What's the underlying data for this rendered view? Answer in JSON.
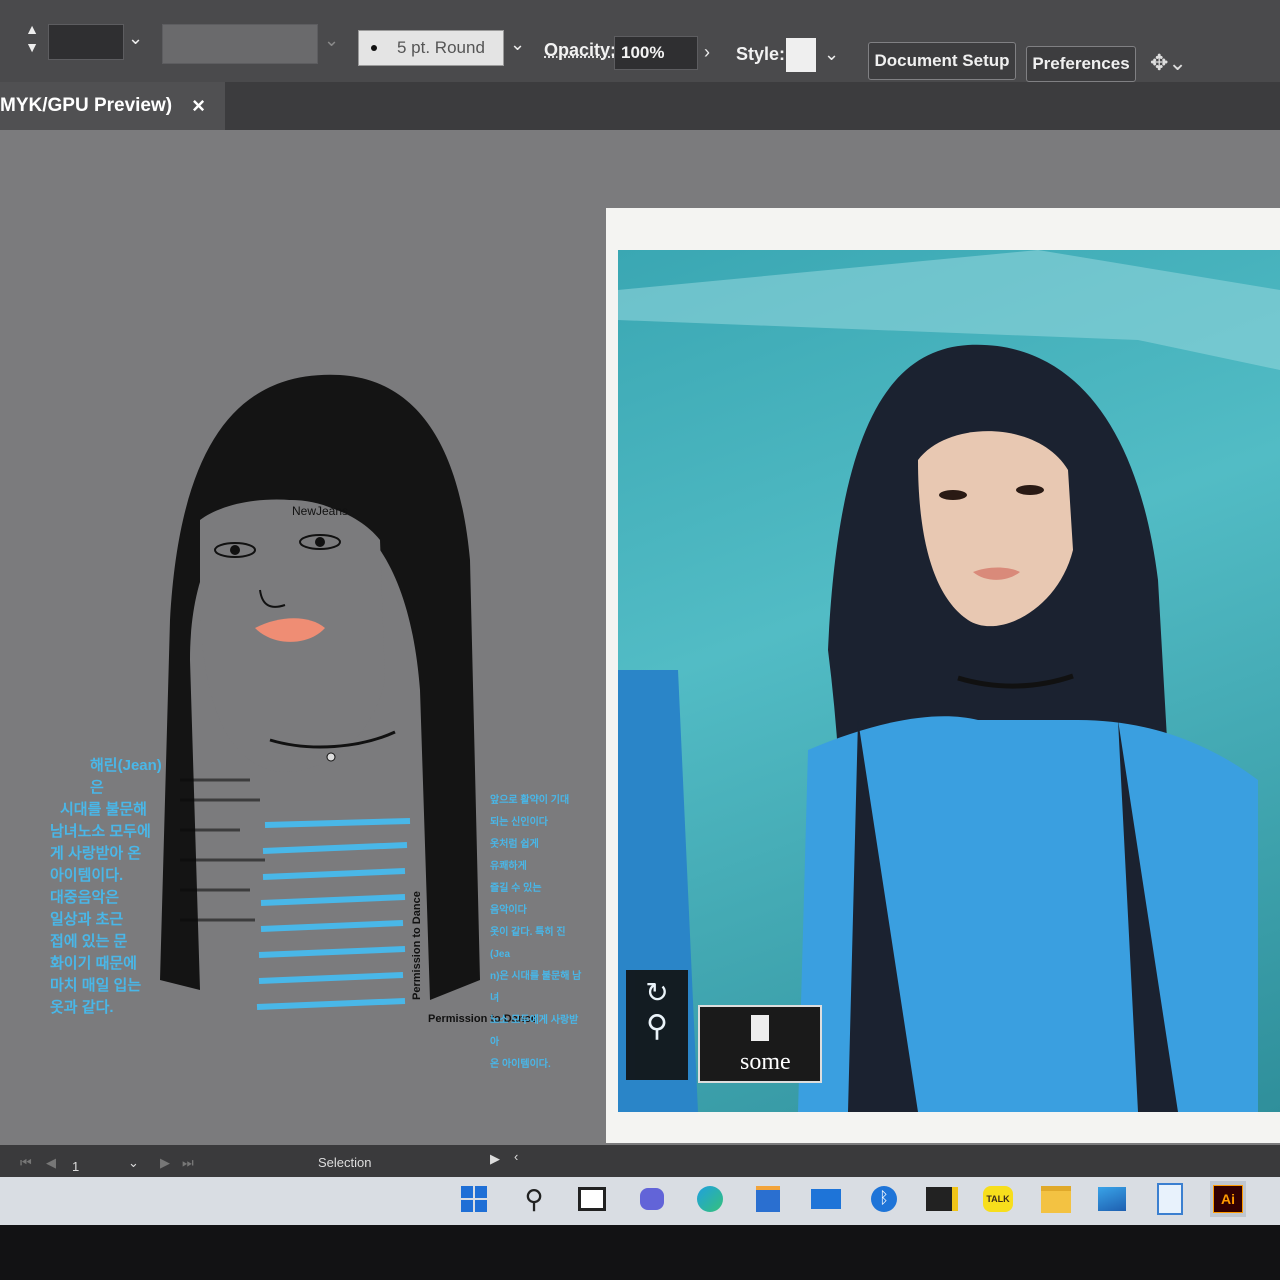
{
  "control_bar": {
    "stroke_profile": "5 pt. Round",
    "opacity_label": "Opacity:",
    "opacity_value": "100%",
    "style_label": "Style:",
    "document_setup": "Document Setup",
    "preferences": "Preferences"
  },
  "document_tab": {
    "title": "MYK/GPU Preview)",
    "close_glyph": "×"
  },
  "artwork": {
    "portrait_texts": [
      "NewJeans",
      "Permission to Dance",
      "Permission to Dance"
    ],
    "left_block": [
      "해린(Jean)은",
      "시대를 불문해",
      "남녀노소 모두에",
      "게 사랑받아 온",
      "아이템이다.",
      "대중음악은",
      "일상과 초근",
      "접에 있는 문",
      "화이기 때문에",
      "마치 매일 입는",
      "옷과 같다."
    ],
    "right_block": [
      "앞으로 활약이 기대",
      "되는 신인이다",
      "옷처럼 쉽게",
      "유쾌하게",
      "즐길 수 있는",
      "음악이다",
      "옷이 같다. 특히 진(Jea",
      "n)은 시대를 불문해 남녀",
      "노소 모두에게 사랑받아",
      "온 아이템이다."
    ],
    "colors": {
      "hair_text": "#111111",
      "lips": "#ef8d74",
      "cyan_text": "#49b7e8"
    }
  },
  "photo_overlay": {
    "label": "some"
  },
  "status_bar": {
    "page_number": "1",
    "tool_name": "Selection"
  },
  "taskbar": {
    "apps": [
      "start-icon",
      "search-icon",
      "task-view-icon",
      "chat-icon",
      "edge-icon",
      "store-icon",
      "mail-icon",
      "bluetooth-icon",
      "sticky-notes-icon",
      "kakaotalk-icon",
      "file-explorer-icon",
      "photos-icon",
      "notepad-icon",
      "illustrator-icon"
    ],
    "kakaotalk_label": "TALK",
    "illustrator_label": "Ai"
  }
}
